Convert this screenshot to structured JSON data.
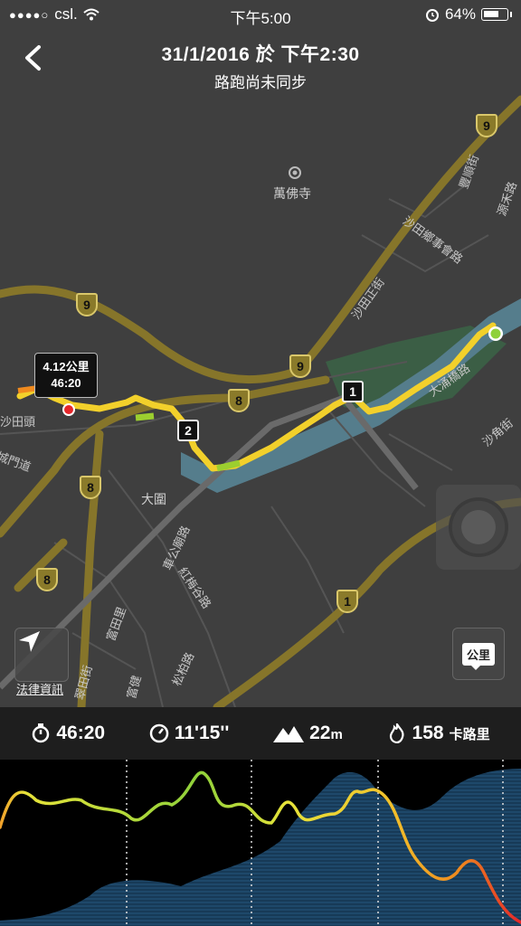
{
  "status_bar": {
    "carrier": "csl.",
    "time": "下午5:00",
    "battery": "64%"
  },
  "header": {
    "title": "31/1/2016 於 下午2:30",
    "subtitle": "路跑尚未同步"
  },
  "map": {
    "route_labels": [
      "9",
      "9",
      "9",
      "8",
      "8",
      "8",
      "1"
    ],
    "place_labels": [
      "萬佛寺",
      "大圍"
    ],
    "street_labels": [
      "沙田鄉事會路",
      "沙田正街",
      "豐順街",
      "源禾路",
      "大涌橋路",
      "沙角街",
      "城門道",
      "車公廟路",
      "紅梅谷路",
      "富田里",
      "松柏路",
      "翠田街",
      "富健",
      "沙田頭"
    ],
    "callout": {
      "distance": "4.12公里",
      "time": "46:20"
    },
    "mile_markers": [
      "1",
      "2"
    ],
    "unit_button_label": "公里",
    "legal_link": "法律資訊"
  },
  "stats": {
    "duration": "46:20",
    "pace": "11'15''",
    "elevation_value": "22",
    "elevation_unit": "m",
    "calories_value": "158",
    "calories_unit": "卡路里"
  },
  "colors": {
    "route_yellow": "#f2d02b",
    "route_green": "#9ccf2f",
    "route_orange": "#f08a1e",
    "route_red": "#e5262a",
    "map_bg": "#3f3f3f",
    "road_major": "#7a6a26",
    "river": "#5f8a9a",
    "park": "#3f6a4a",
    "graph_area": "#1f4a6b"
  }
}
